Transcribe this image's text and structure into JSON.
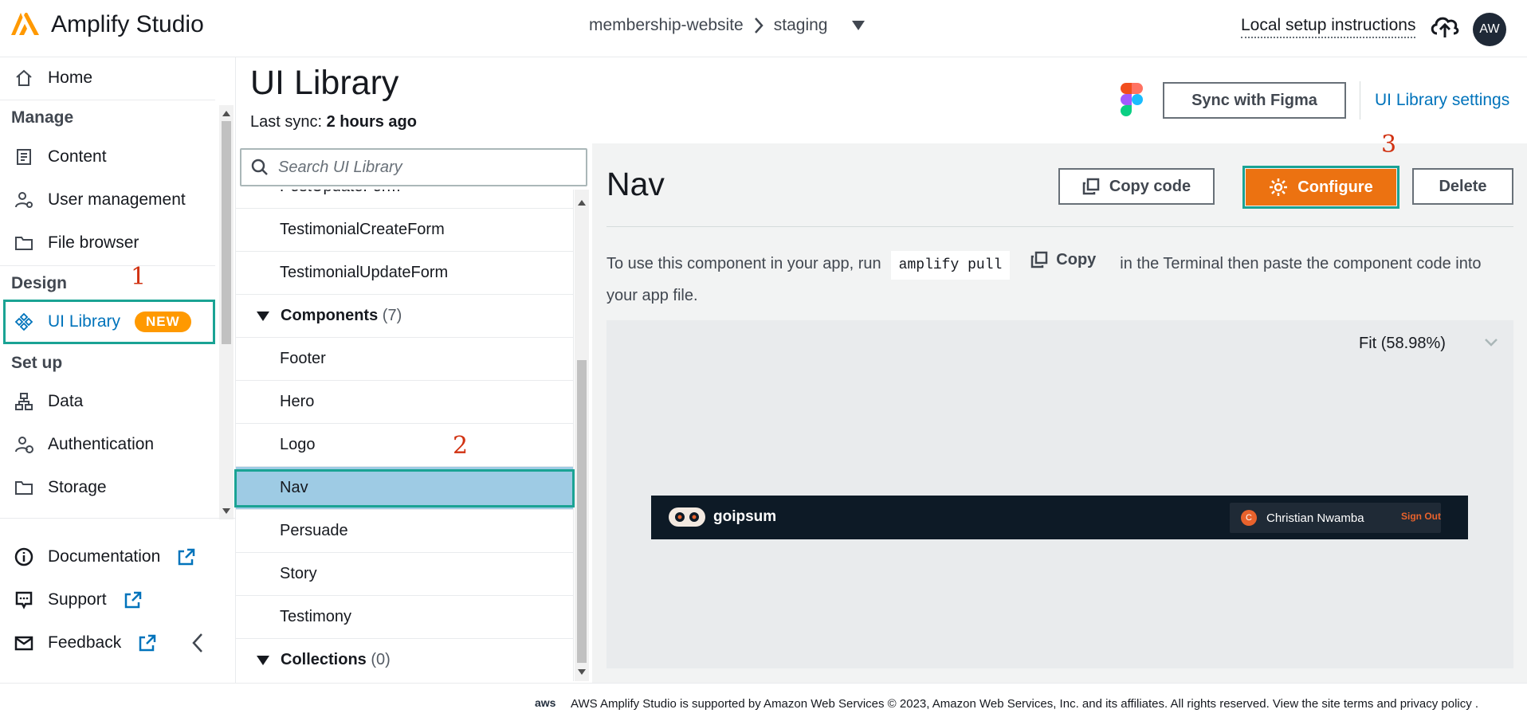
{
  "app": {
    "title": "Amplify Studio"
  },
  "header": {
    "project": "membership-website",
    "environment": "staging",
    "local_setup": "Local setup instructions",
    "avatar_initials": "AW"
  },
  "sidebar": {
    "home": "Home",
    "manage_title": "Manage",
    "manage_items": [
      "Content",
      "User management",
      "File browser"
    ],
    "design_title": "Design",
    "ui_library": "UI Library",
    "new_badge": "NEW",
    "setup_title": "Set up",
    "setup_items": [
      "Data",
      "Authentication",
      "Storage"
    ],
    "footer_links": [
      "Documentation",
      "Support",
      "Feedback"
    ]
  },
  "annotations": {
    "one": "1",
    "two": "2",
    "three": "3"
  },
  "library": {
    "title": "UI Library",
    "last_sync_label": "Last sync:",
    "last_sync_value": "2 hours ago",
    "sync_button": "Sync with Figma",
    "settings_link": "UI Library settings",
    "search_placeholder": "Search UI Library",
    "partial_item": "PostUpdateForm",
    "form_items": [
      "TestimonialCreateForm",
      "TestimonialUpdateForm"
    ],
    "components_label": "Components",
    "components_count": "(7)",
    "components": [
      "Footer",
      "Hero",
      "Logo",
      "Nav",
      "Persuade",
      "Story",
      "Testimony"
    ],
    "collections_label": "Collections",
    "collections_count": "(0)"
  },
  "detail": {
    "title": "Nav",
    "copy_code": "Copy code",
    "configure": "Configure",
    "delete": "Delete",
    "instr_before": "To use this component in your app, run",
    "command": "amplify pull",
    "copy": "Copy",
    "instr_after": "in the Terminal then paste the component code into your app file.",
    "fit": "Fit (58.98%)"
  },
  "preview": {
    "brand": "goipsum",
    "user_initial": "C",
    "user_name": "Christian Nwamba",
    "sign_out": "Sign Out"
  },
  "footer": {
    "aws": "aws",
    "text": "AWS Amplify Studio is supported by Amazon Web Services © 2023, Amazon Web Services, Inc. and its affiliates. All rights reserved. View the site terms and privacy policy ."
  },
  "colors": {
    "accent": "#ff9900",
    "configure": "#ec7211",
    "highlight": "#1aa394",
    "link": "#0073bb",
    "selected": "#9ecbe4"
  }
}
